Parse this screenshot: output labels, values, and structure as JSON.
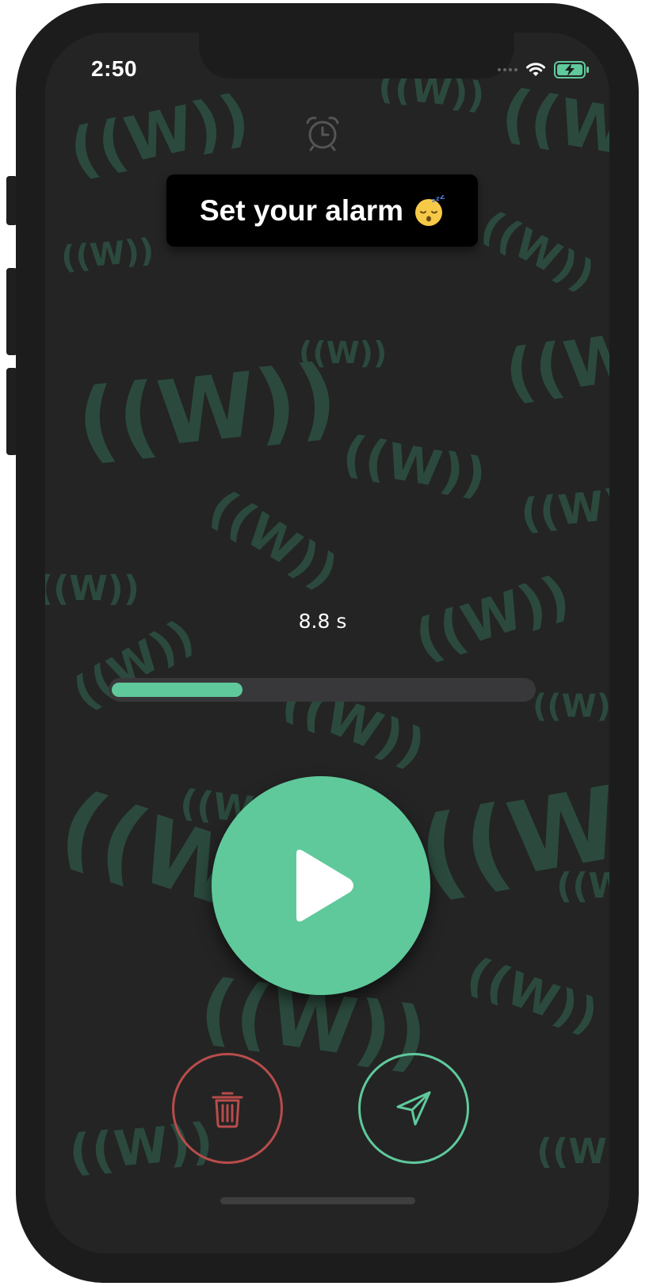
{
  "status_bar": {
    "time": "2:50"
  },
  "banner": {
    "text": "Set your alarm",
    "emoji": "sleeping-face"
  },
  "recording": {
    "duration_label": "8.8 s",
    "progress_fraction": 0.31
  },
  "controls": {
    "play_icon": "play-icon",
    "delete_icon": "trash-icon",
    "send_icon": "send-icon"
  },
  "colors": {
    "background": "#242424",
    "accent_green": "#5fc99b",
    "danger_red": "#b84c4b",
    "track": "#38383a",
    "watermark": "#2b4a3d"
  }
}
